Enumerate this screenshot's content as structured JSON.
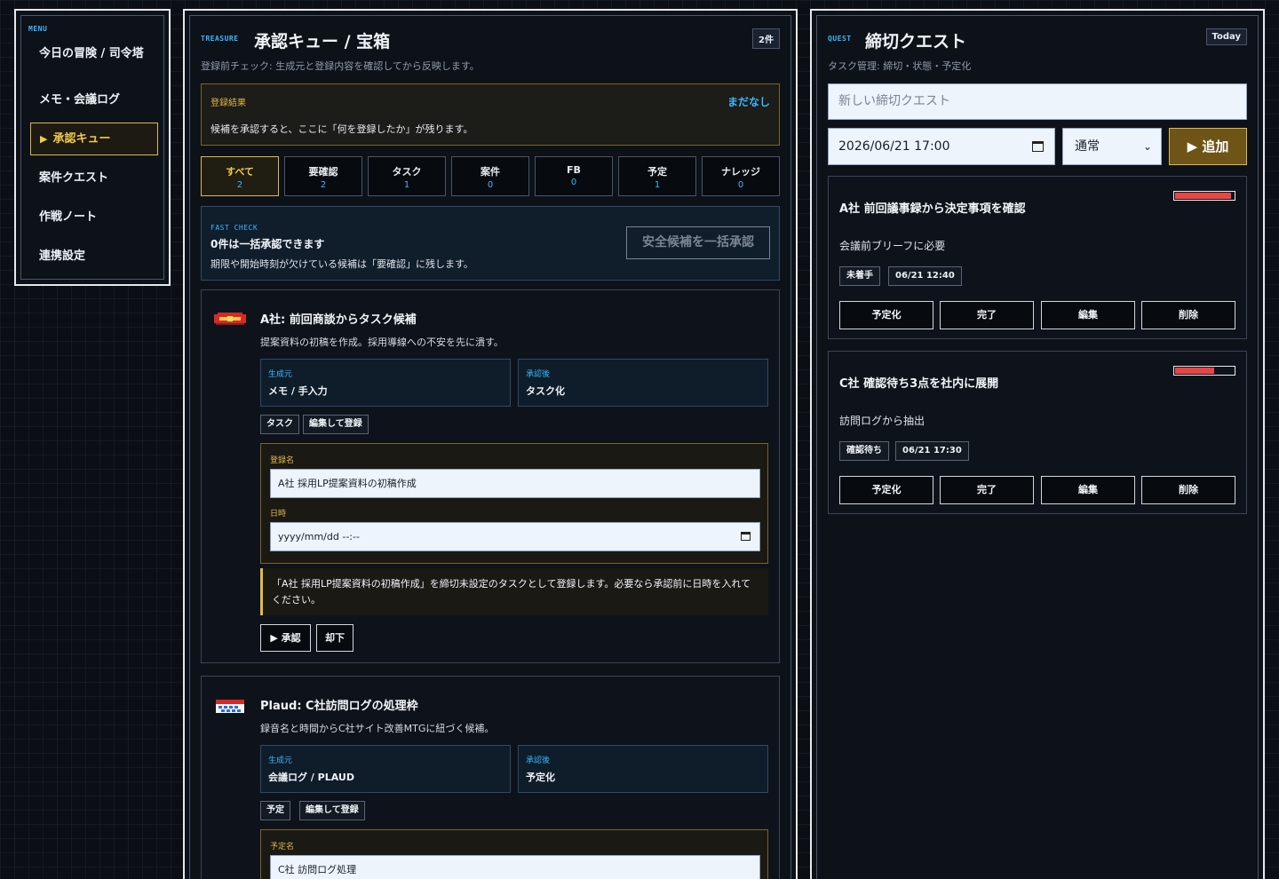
{
  "sidebar": {
    "menu_label": "MENU",
    "items": [
      {
        "label": "今日の冒険 / 司令塔"
      },
      {
        "label": "メモ・会議ログ"
      },
      {
        "label": "承認キュー",
        "active": true
      },
      {
        "label": "案件クエスト"
      },
      {
        "label": "作戦ノート"
      },
      {
        "label": "連携設定"
      }
    ]
  },
  "treasure": {
    "tag": "TREASURE",
    "title": "承認キュー / 宝箱",
    "count": "2件",
    "subtitle": "登録前チェック: 生成元と登録内容を確認してから反映します。",
    "result": {
      "label": "登録結果",
      "state": "まだなし",
      "message": "候補を承認すると、ここに「何を登録したか」が残ります。"
    },
    "tabs": [
      {
        "label": "すべて",
        "count": "2",
        "active": true
      },
      {
        "label": "要確認",
        "count": "2"
      },
      {
        "label": "タスク",
        "count": "1"
      },
      {
        "label": "案件",
        "count": "0"
      },
      {
        "label": "FB",
        "count": "0"
      },
      {
        "label": "予定",
        "count": "1"
      },
      {
        "label": "ナレッジ",
        "count": "0"
      }
    ],
    "fast_check": {
      "tag": "FAST CHECK",
      "heading": "0件は一括承認できます",
      "description": "期限や開始時刻が欠けている候補は「要確認」に残します。",
      "button": "安全候補を一括承認"
    },
    "cards": [
      {
        "title": "A社: 前回商談からタスク候補",
        "description": "提案資料の初稿を作成。採用導線への不安を先に潰す。",
        "source_label": "生成元",
        "source_value": "メモ / 手入力",
        "after_label": "承認後",
        "after_value": "タスク化",
        "chips": [
          "タスク",
          "編集して登録"
        ],
        "name_label": "登録名",
        "name_value": "A社 採用LP提案資料の初稿作成",
        "date_label": "日時",
        "date_value": "yyyy/mm/dd --:--",
        "note": "「A社 採用LP提案資料の初稿作成」を締切未設定のタスクとして登録します。必要なら承認前に日時を入れてください。",
        "approve": "▶ 承認",
        "reject": "却下"
      },
      {
        "title": "Plaud: C社訪問ログの処理枠",
        "description": "録音名と時間からC社サイト改善MTGに紐づく候補。",
        "source_label": "生成元",
        "source_value": "会議ログ / PLAUD",
        "after_label": "承認後",
        "after_value": "予定化",
        "chips": [
          "予定",
          "編集して登録"
        ],
        "name_label": "予定名",
        "name_value": "C社 訪問ログ処理"
      }
    ]
  },
  "quest": {
    "tag": "QUEST",
    "title": "締切クエスト",
    "badge": "Today",
    "subtitle": "タスク管理: 締切・状態・予定化",
    "new_placeholder": "新しい締切クエスト",
    "date_value": "2026/06/21 17:00",
    "priority_value": "通常",
    "add_button": "▶ 追加",
    "items": [
      {
        "title": "A社 前回議事録から決定事項を確認",
        "description": "会議前ブリーフに必要",
        "status": "未着手",
        "due": "06/21 12:40",
        "urgency": 0.95
      },
      {
        "title": "C社 確認待ち3点を社内に展開",
        "description": "訪問ログから抽出",
        "status": "確認待ち",
        "due": "06/21 17:30",
        "urgency": 0.68
      }
    ],
    "actions": [
      "予定化",
      "完了",
      "編集",
      "削除"
    ]
  },
  "colors": {
    "accent_gold": "#e0b84a",
    "accent_blue": "#39b8ff",
    "urgency_red": "#e94545",
    "background": "#0b0f15"
  }
}
